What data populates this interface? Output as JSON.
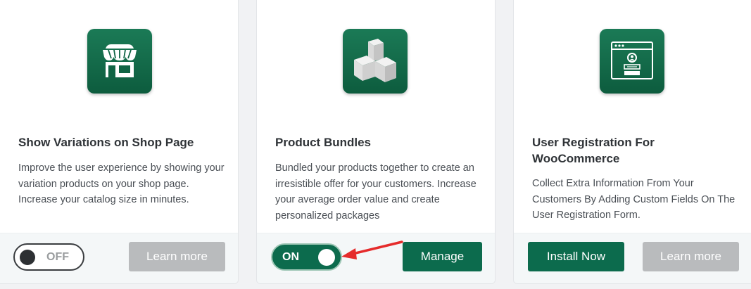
{
  "cards": [
    {
      "title": "Show Variations on Shop Page",
      "description": "Improve the user experience by showing your variation products on your shop page. Increase your catalog size in minutes.",
      "icon": "storefront-icon",
      "toggle": {
        "state": "off",
        "label": "OFF"
      },
      "learn_more_label": "Learn more"
    },
    {
      "title": "Product Bundles",
      "description": "Bundled your products together to create an irresistible offer for your customers. Increase your average order value and create personalized packages",
      "icon": "boxes-icon",
      "toggle": {
        "state": "on",
        "label": "ON"
      },
      "manage_label": "Manage"
    },
    {
      "title": "User Registration For WooCommerce",
      "description": "Collect Extra Information From Your Customers By Adding Custom Fields On The User Registration Form.",
      "icon": "user-registration-icon",
      "install_label": "Install Now",
      "learn_more_label": "Learn more"
    }
  ],
  "colors": {
    "brand_green": "#0c6b4d",
    "disabled_gray": "#b9bbbd",
    "annotation_red": "#e52b2b"
  }
}
